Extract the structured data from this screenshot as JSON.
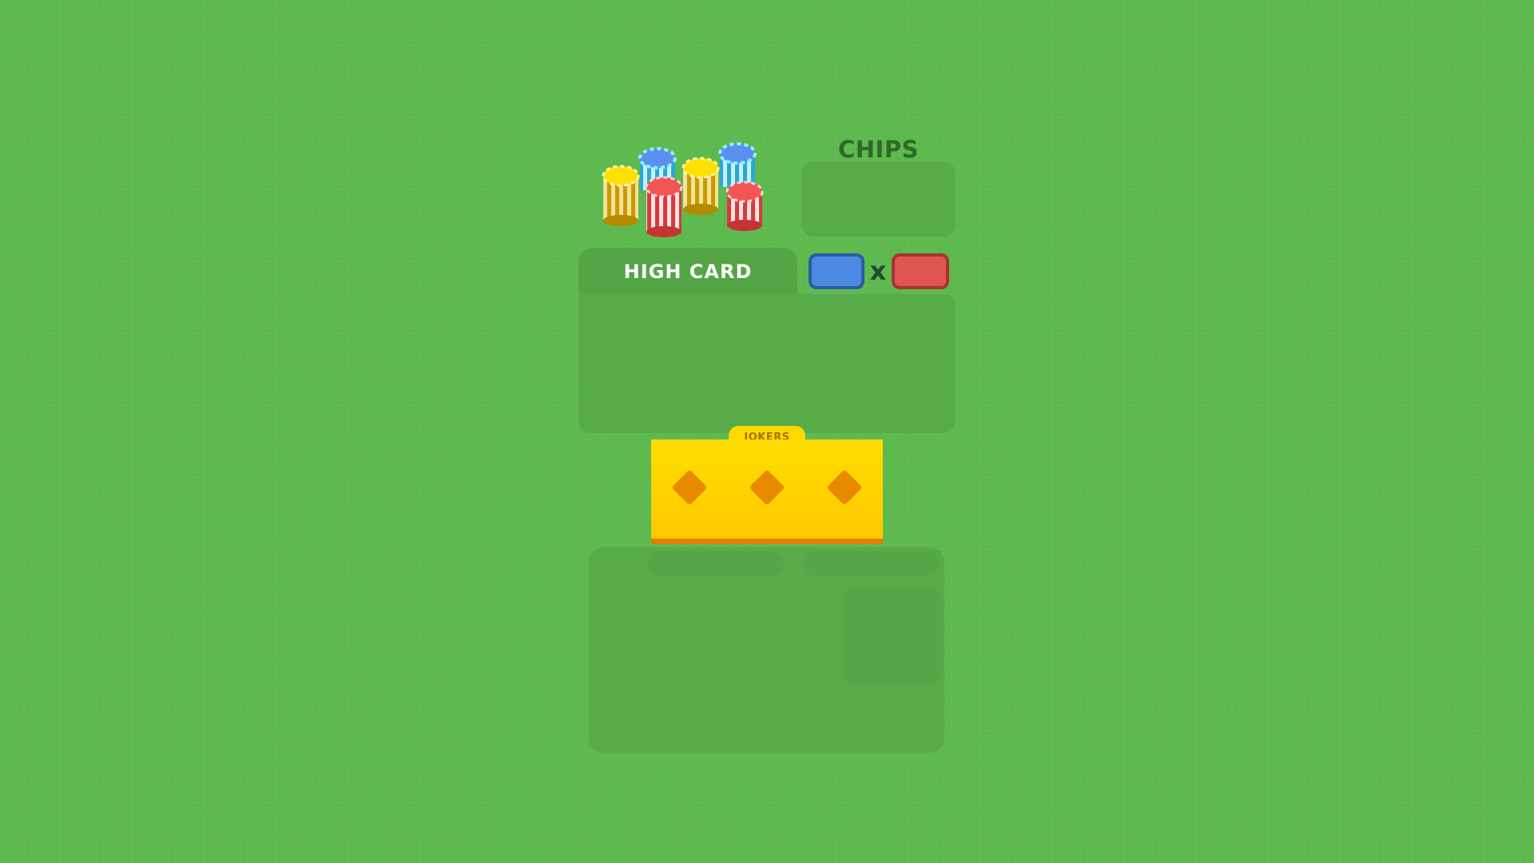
{
  "hand": {
    "name": "HIGH CARD"
  },
  "score": {
    "chips_title": "CHIPS",
    "times_symbol": "x"
  },
  "jokers": {
    "label": "JOKERS",
    "slot_count": 3
  },
  "colors": {
    "table": "#5eb94f",
    "chips_color": "#4d8be2",
    "mult_color": "#e05551",
    "jokers_yellow": "#ffd800",
    "jokers_orange": "#e88a00"
  },
  "icons": {
    "chip_stacks": [
      "yellow-chip-stack-icon",
      "blue-chip-stack-icon",
      "red-chip-stack-icon",
      "yellow-chip-stack-icon",
      "blue-chip-stack-icon",
      "red-chip-stack-icon"
    ],
    "joker_slot": "diamond-icon"
  }
}
